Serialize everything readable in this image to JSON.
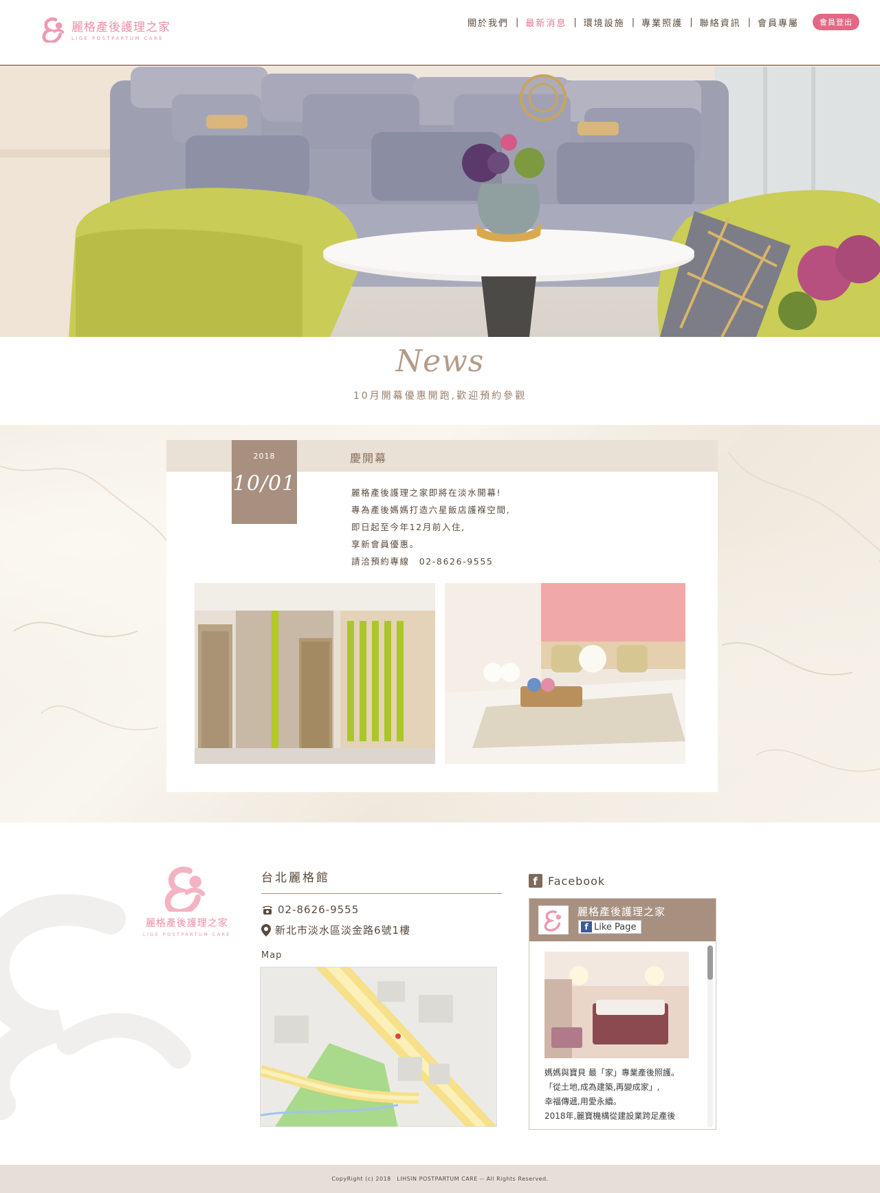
{
  "header": {
    "logo_cn": "麗格產後護理之家",
    "logo_en": "LIGE POSTPARTUM CARE",
    "nav": [
      {
        "label": "關於我們",
        "active": false
      },
      {
        "label": "最新消息",
        "active": true
      },
      {
        "label": "環境設施",
        "active": false
      },
      {
        "label": "專業照護",
        "active": false
      },
      {
        "label": "聯絡資訊",
        "active": false
      },
      {
        "label": "會員專屬",
        "active": false
      }
    ],
    "logout_label": "會員登出"
  },
  "news": {
    "heading": "News",
    "subtitle": "10月開幕優惠開跑,歡迎預約參觀"
  },
  "article": {
    "year": "2018",
    "date": "10/01",
    "title": "慶開幕",
    "lines": [
      "麗格產後護理之家即將在淡水開幕!",
      "專為產後媽媽打造六星飯店護褓空間,",
      "即日起至今年12月前入住,",
      "享新會員優惠。",
      "請洽預約專線　02-8626-9555"
    ]
  },
  "footer": {
    "logo_cn": "麗格產後護理之家",
    "logo_en": "LIGE POSTPARTUM CARE",
    "branch_title": "台北麗格館",
    "phone": "02-8626-9555",
    "address": "新北市淡水區淡金路6號1樓",
    "map_label": "Map",
    "facebook_label": "Facebook",
    "fb_page_name": "麗格產後護理之家",
    "fb_like_label": "Like Page",
    "fb_post_lines": [
      "媽媽與寶貝 最「家」專業產後照護。",
      "「從土地,成為建築,再變成家」,",
      "幸福傳遞,用愛永續。",
      "2018年,麗寶機構從建設業跨足產後"
    ]
  },
  "copyright": "CopyRight (c) 2018　LIHSIN POSTPARTUM CARE -- All Rights Reserved.",
  "colors": {
    "accent_pink": "#e06a85",
    "brand_brown": "#a89080",
    "nav_active": "#e37a92"
  }
}
